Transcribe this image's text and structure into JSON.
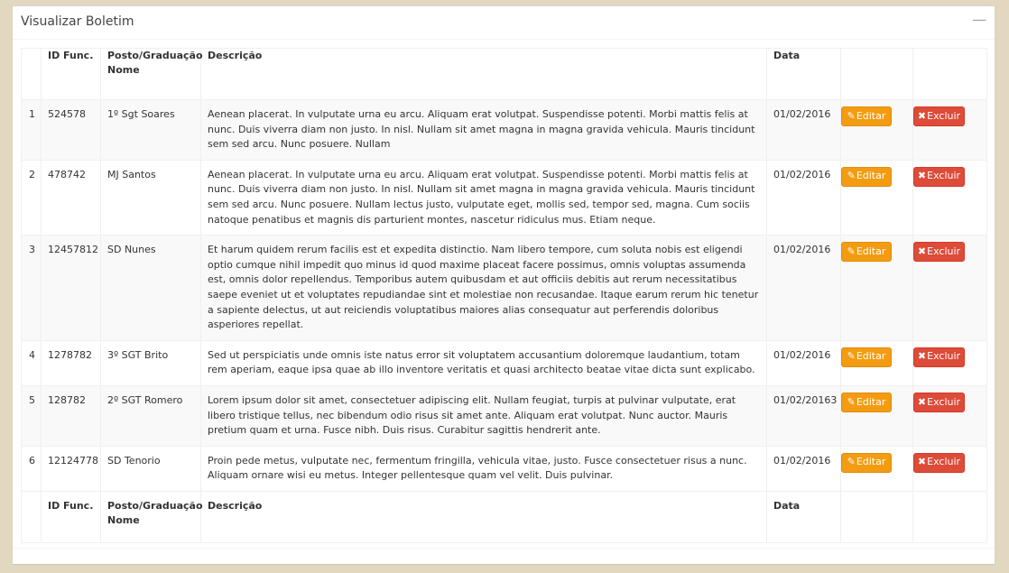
{
  "panel": {
    "title": "Visualizar Boletim",
    "collapse_icon": "minus-icon"
  },
  "columns": {
    "num": "",
    "id": "ID Func.",
    "posto": "Posto/Graduação Nome",
    "descricao": "Descrição",
    "data": "Data"
  },
  "actions": {
    "edit_label": "Editar",
    "edit_icon": "edit-icon",
    "delete_label": "Excluir",
    "delete_icon": "times-icon"
  },
  "colors": {
    "edit": "#f39c12",
    "delete": "#dd4b39",
    "background": "#e2d7bf"
  },
  "rows": [
    {
      "num": "1",
      "id": "524578",
      "posto": "1º Sgt Soares",
      "descricao": "Aenean placerat. In vulputate urna eu arcu. Aliquam erat volutpat. Suspendisse potenti. Morbi mattis felis at nunc. Duis viverra diam non justo. In nisl. Nullam sit amet magna in magna gravida vehicula. Mauris tincidunt sem sed arcu. Nunc posuere. Nullam",
      "data": "01/02/2016"
    },
    {
      "num": "2",
      "id": "478742",
      "posto": "MJ Santos",
      "descricao": "Aenean placerat. In vulputate urna eu arcu. Aliquam erat volutpat. Suspendisse potenti. Morbi mattis felis at nunc. Duis viverra diam non justo. In nisl. Nullam sit amet magna in magna gravida vehicula. Mauris tincidunt sem sed arcu. Nunc posuere. Nullam lectus justo, vulputate eget, mollis sed, tempor sed, magna. Cum sociis natoque penatibus et magnis dis parturient montes, nascetur ridiculus mus. Etiam neque.",
      "data": "01/02/2016"
    },
    {
      "num": "3",
      "id": "12457812",
      "posto": "SD Nunes",
      "descricao": "Et harum quidem rerum facilis est et expedita distinctio. Nam libero tempore, cum soluta nobis est eligendi optio cumque nihil impedit quo minus id quod maxime placeat facere possimus, omnis voluptas assumenda est, omnis dolor repellendus. Temporibus autem quibusdam et aut officiis debitis aut rerum necessitatibus saepe eveniet ut et voluptates repudiandae sint et molestiae non recusandae. Itaque earum rerum hic tenetur a sapiente delectus, ut aut reiciendis voluptatibus maiores alias consequatur aut perferendis doloribus asperiores repellat.",
      "data": "01/02/2016"
    },
    {
      "num": "4",
      "id": "1278782",
      "posto": "3º SGT Brito",
      "descricao": "Sed ut perspiciatis unde omnis iste natus error sit voluptatem accusantium doloremque laudantium, totam rem aperiam, eaque ipsa quae ab illo inventore veritatis et quasi architecto beatae vitae dicta sunt explicabo.",
      "data": "01/02/2016"
    },
    {
      "num": "5",
      "id": "128782",
      "posto": "2º SGT Romero",
      "descricao": "Lorem ipsum dolor sit amet, consectetuer adipiscing elit. Nullam feugiat, turpis at pulvinar vulputate, erat libero tristique tellus, nec bibendum odio risus sit amet ante. Aliquam erat volutpat. Nunc auctor. Mauris pretium quam et urna. Fusce nibh. Duis risus. Curabitur sagittis hendrerit ante.",
      "data": "01/02/20163"
    },
    {
      "num": "6",
      "id": "12124778",
      "posto": "SD Tenorio",
      "descricao": "Proin pede metus, vulputate nec, fermentum fringilla, vehicula vitae, justo. Fusce consectetuer risus a nunc. Aliquam ornare wisi eu metus. Integer pellentesque quam vel velit. Duis pulvinar.",
      "data": "01/02/2016"
    }
  ]
}
